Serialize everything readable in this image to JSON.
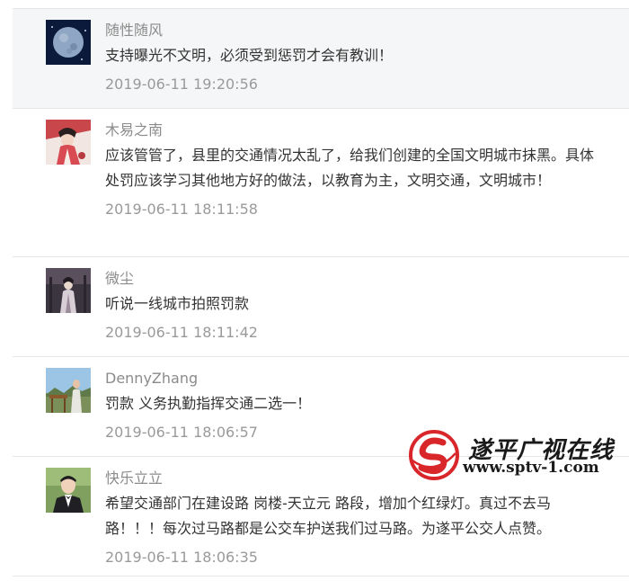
{
  "comments": [
    {
      "username": "随性随风",
      "content": "支持曝光不文明，必须受到惩罚才会有教训！",
      "time": "2019-06-11 19:20:56",
      "avatar_icon": "moon-avatar"
    },
    {
      "username": "木易之南",
      "content": "应该管管了，县里的交通情况太乱了，给我们创建的全国文明城市抹黑。具体处罚应该学习其他地方好的做法，以教育为主，文明交通，文明城市！",
      "time": "2019-06-11 18:11:58",
      "avatar_icon": "costume-figure-avatar"
    },
    {
      "username": "微尘",
      "content": "听说一线城市拍照罚款",
      "time": "2019-06-11 18:11:42",
      "avatar_icon": "illustration-figure-avatar"
    },
    {
      "username": "DennyZhang",
      "content": "罚款 义务执勤指挥交通二选一！",
      "time": "2019-06-11 18:06:57",
      "avatar_icon": "outdoor-person-avatar"
    },
    {
      "username": "快乐立立",
      "content": "希望交通部门在建设路 岗楼-天立元 路段，增加个红绿灯。真过不去马路！！！每次过马路都是公交车护送我们过马路。为遂平公交人点赞。",
      "time": "2019-06-11 18:06:35",
      "avatar_icon": "suit-person-avatar"
    }
  ],
  "watermark": {
    "name": "遂平广视在线",
    "url": "www.sptv-1.com",
    "logo_icon": "sptv-logo-icon",
    "logo_color": "#d9262b"
  },
  "colors": {
    "highlight_bg": "#f5f6f7",
    "username": "#8b8b8b",
    "content": "#333333",
    "time": "#9a9a9a",
    "divider": "#e6e6e6"
  }
}
